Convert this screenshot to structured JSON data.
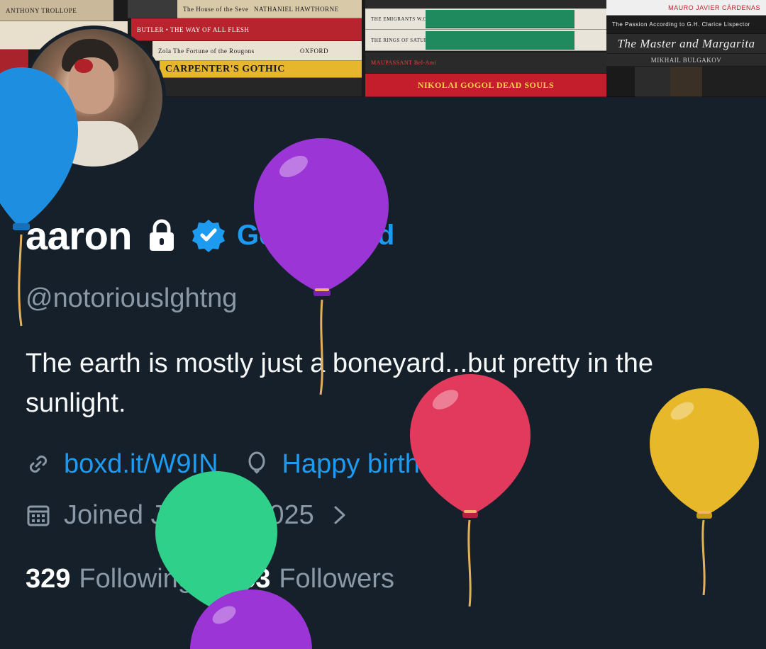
{
  "banner": {
    "books": [
      {
        "title": "ANTHONY TROLLOPE",
        "color": "#c9b99a"
      },
      {
        "title": "The House of the Seven Gables",
        "color": "#d8c9a8"
      },
      {
        "title": "NATHANIEL HAWTHORNE",
        "color": "#d8c9a8"
      },
      {
        "title": "BUTLER • THE WAY OF ALL FLESH",
        "color": "#b8242e"
      },
      {
        "title": "Zola  The Fortune of the Rougons",
        "color": "#e9e2d3"
      },
      {
        "title": "OXFORD",
        "color": "#e9e2d3"
      },
      {
        "title": "CARPENTER'S GOTHIC",
        "color": "#e6b72d"
      },
      {
        "title": "THE EMIGRANTS  W.G. SEBALD",
        "color": "#e8e4da"
      },
      {
        "title": "THE RINGS OF SATURN  W.G. SEBALD",
        "color": "#e8e4da"
      },
      {
        "title": "MAUPASSANT  Bel-Ami",
        "color": "#2a2a2a"
      },
      {
        "title": "NIKOLAI GOGOL  DEAD SOULS",
        "color": "#c41e2c"
      },
      {
        "title": "MAURO JAVIER CÁRDENAS",
        "color": "#efefef"
      },
      {
        "title": "The Passion According to G.H.   Clarice Lispector",
        "color": "#1c1c1c"
      },
      {
        "title": "The Master and Margarita",
        "color": "#2b2b2b"
      },
      {
        "title": "MIKHAIL BULGAKOV",
        "color": "#2b2b2b"
      }
    ]
  },
  "profile": {
    "display_name": "aaron",
    "get_verified_label": "Get Verified",
    "handle": "@notoriouslghtng",
    "bio": "The earth is mostly just a boneyard...but pretty in the sunlight.",
    "website": "boxd.it/W9IN",
    "birthday_text": "Happy birthday!",
    "joined_text": "Joined January 2025",
    "following_count": "329",
    "following_label": "Following",
    "followers_count": "253",
    "followers_label": "Followers"
  },
  "icons": {
    "lock": "lock-icon",
    "verified": "verified-badge-icon",
    "link": "link-icon",
    "balloon": "balloon-icon",
    "calendar": "calendar-icon",
    "chevron": "chevron-right-icon"
  },
  "colors": {
    "background": "#15202b",
    "accent": "#1d9bf0",
    "secondary_text": "#8b98a5",
    "primary_text": "#f7f9f9"
  },
  "balloons": [
    {
      "color": "#1e8fe0"
    },
    {
      "color": "#9b35d6"
    },
    {
      "color": "#e23a5c"
    },
    {
      "color": "#e6b82a"
    },
    {
      "color": "#2fd08a"
    },
    {
      "color": "#9b35d6"
    }
  ]
}
